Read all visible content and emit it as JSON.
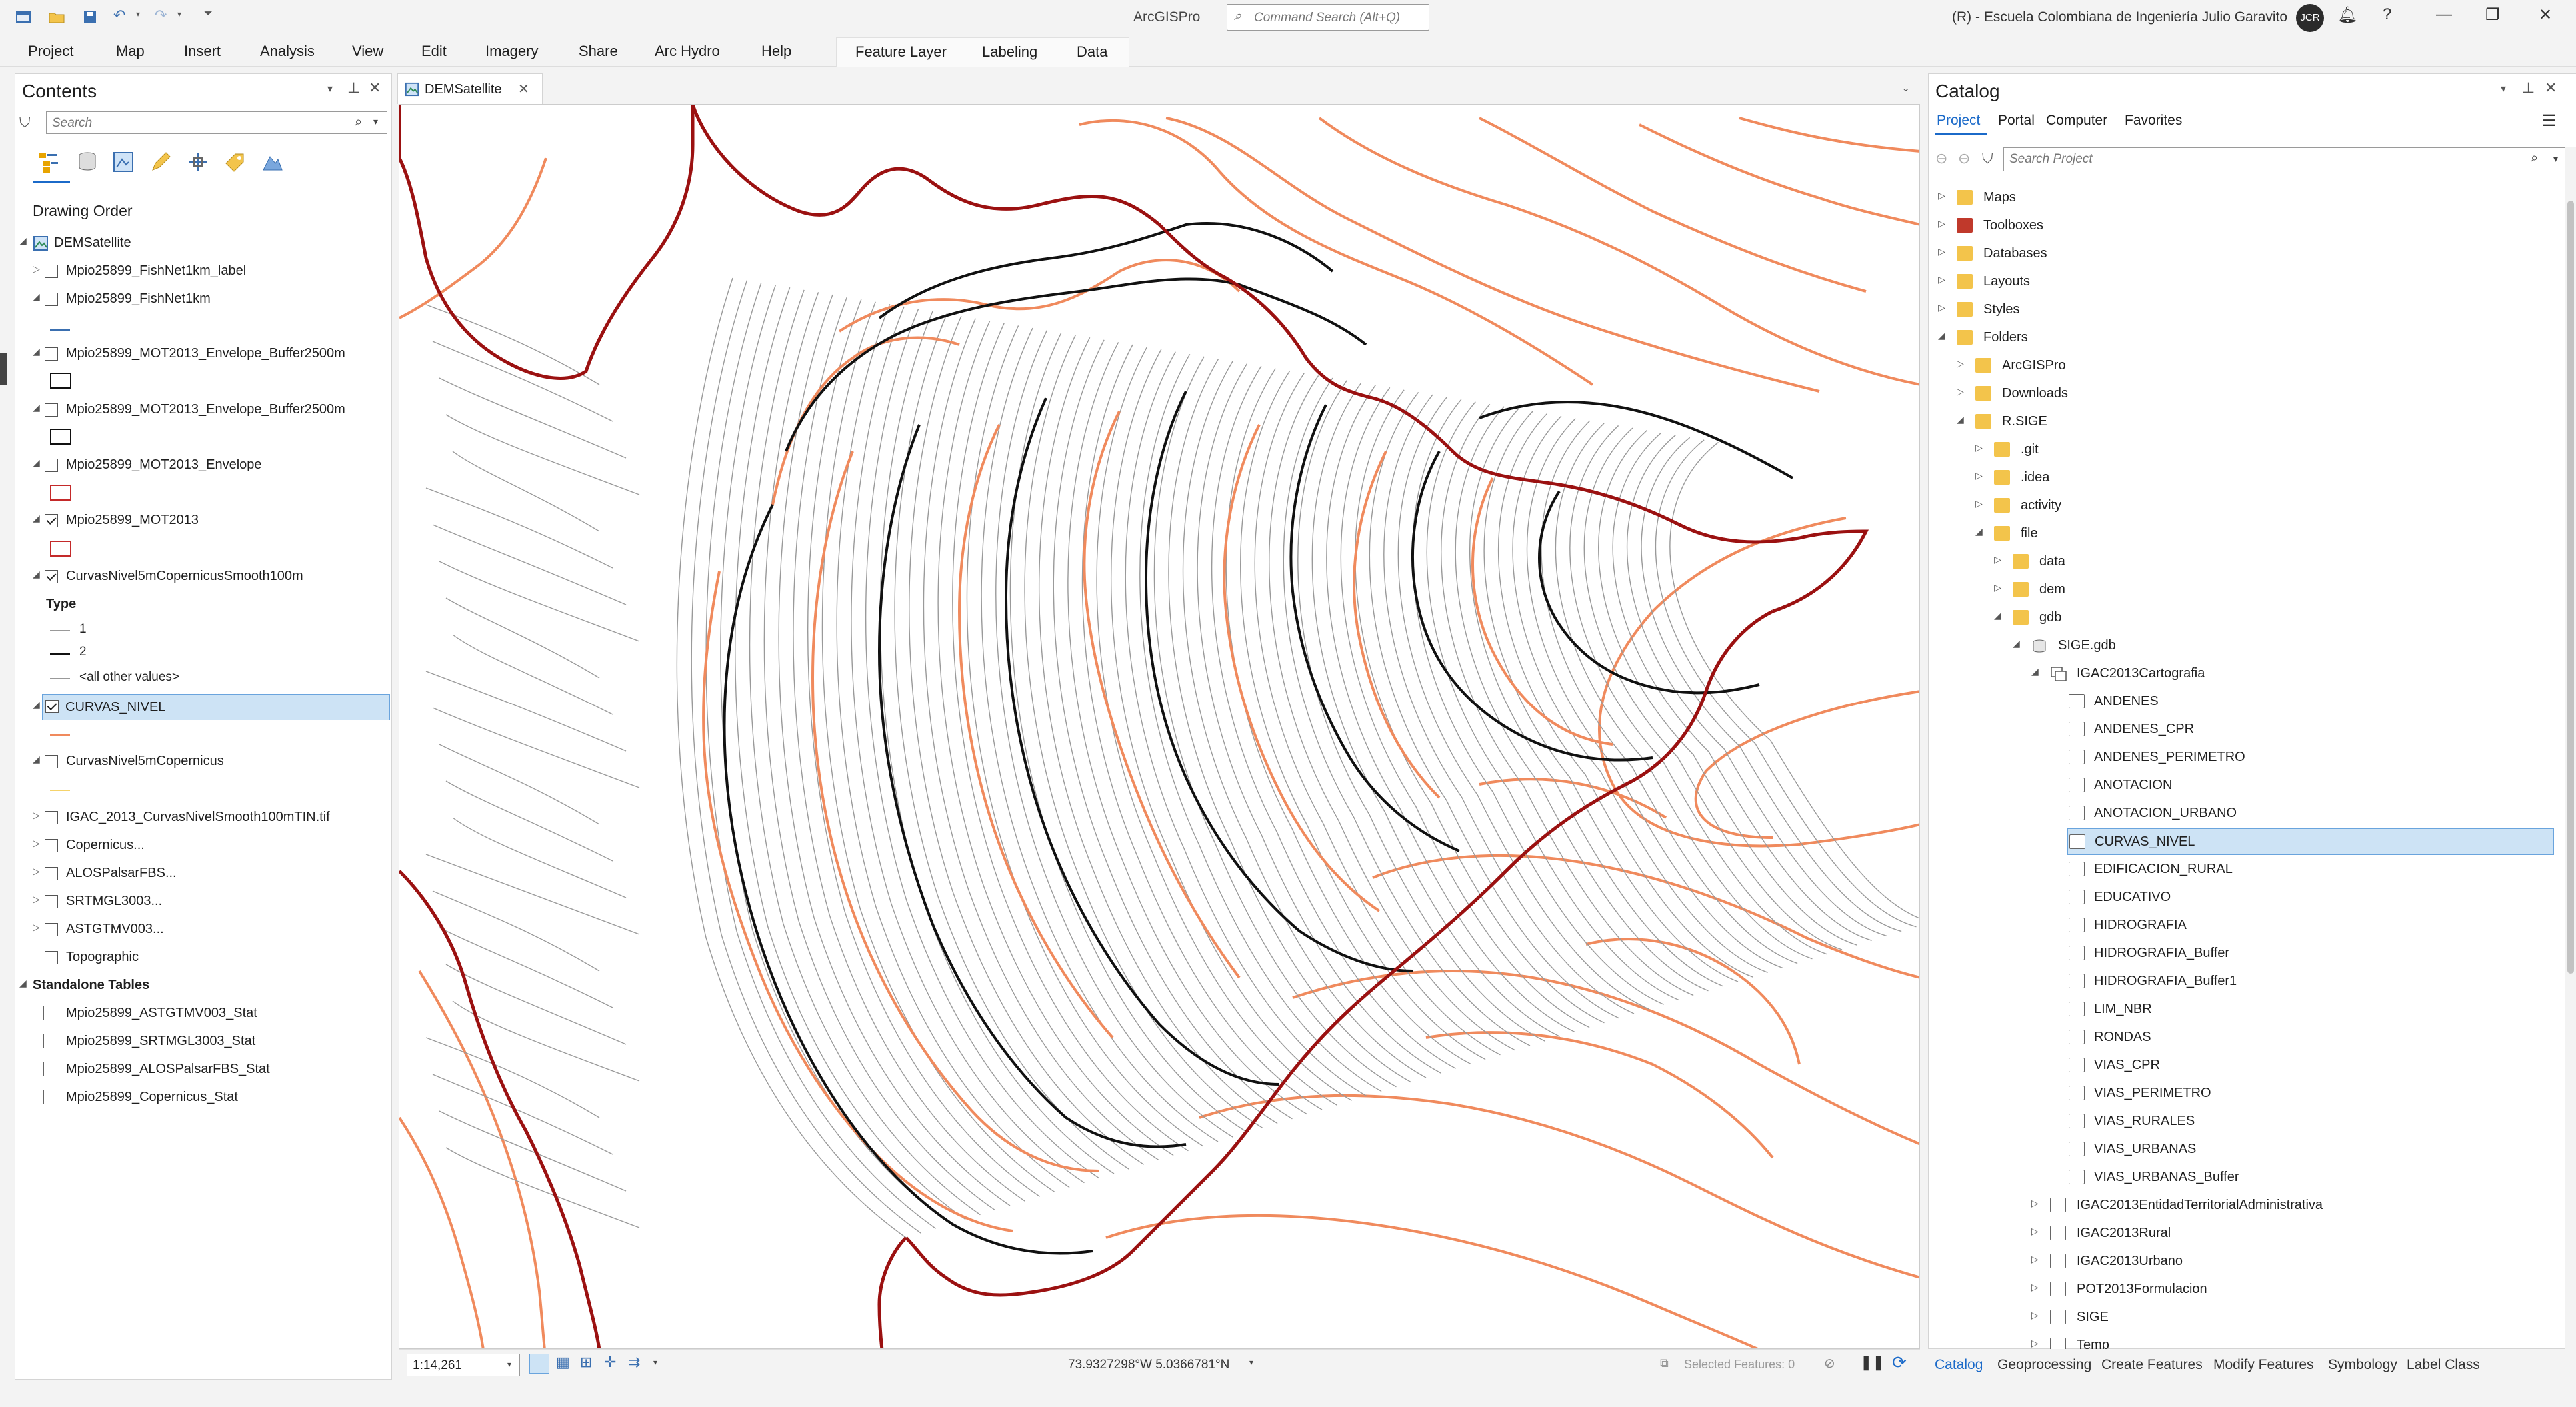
{
  "titlebar": {
    "app_title": "ArcGISPro",
    "command_search_placeholder": "Command Search (Alt+Q)",
    "org_name": "(R) - Escuela Colombiana de Ingeniería Julio Garavito",
    "avatar_initials": "JCR"
  },
  "ribbon": {
    "tabs": [
      "Project",
      "Map",
      "Insert",
      "Analysis",
      "View",
      "Edit",
      "Imagery",
      "Share",
      "Arc Hydro",
      "Help"
    ],
    "contextual_tabs": [
      "Feature Layer",
      "Labeling",
      "Data"
    ]
  },
  "contents": {
    "title": "Contents",
    "search_placeholder": "Search",
    "section_label": "Drawing Order",
    "map_name": "DEMSatellite",
    "layers": [
      {
        "label": "Mpio25899_FishNet1km_label",
        "checked": false
      },
      {
        "label": "Mpio25899_FishNet1km",
        "checked": false
      },
      {
        "label": "Mpio25899_MOT2013_Envelope_Buffer2500m",
        "checked": false
      },
      {
        "label": "Mpio25899_MOT2013_Envelope_Buffer2500m",
        "checked": false
      },
      {
        "label": "Mpio25899_MOT2013_Envelope",
        "checked": false
      },
      {
        "label": "Mpio25899_MOT2013",
        "checked": true
      },
      {
        "label": "CurvasNivel5mCopernicusSmooth100m",
        "checked": true
      },
      {
        "label": "CURVAS_NIVEL",
        "checked": true,
        "selected": true
      },
      {
        "label": "CurvasNivel5mCopernicus",
        "checked": false
      },
      {
        "label": "IGAC_2013_CurvasNivelSmooth100mTIN.tif",
        "checked": false
      },
      {
        "label": "Copernicus...",
        "checked": false
      },
      {
        "label": "ALOSPalsarFBS...",
        "checked": false
      },
      {
        "label": "SRTMGL3003...",
        "checked": false
      },
      {
        "label": "ASTGTMV003...",
        "checked": false
      },
      {
        "label": "Topographic",
        "checked": false
      }
    ],
    "legend": {
      "heading": "Type",
      "items": [
        "1",
        "2",
        "<all other values>"
      ]
    },
    "standalone_heading": "Standalone Tables",
    "tables": [
      "Mpio25899_ASTGTMV003_Stat",
      "Mpio25899_SRTMGL3003_Stat",
      "Mpio25899_ALOSPalsarFBS_Stat",
      "Mpio25899_Copernicus_Stat"
    ]
  },
  "map_view": {
    "tab_label": "DEMSatellite",
    "scale": "1:14,261",
    "coordinates": "73.9327298°W 5.0366781°N",
    "selected_features": "Selected Features: 0"
  },
  "catalog": {
    "title": "Catalog",
    "tabs": [
      "Project",
      "Portal",
      "Computer",
      "Favorites"
    ],
    "search_placeholder": "Search Project",
    "top_items": [
      "Maps",
      "Toolboxes",
      "Databases",
      "Layouts",
      "Styles",
      "Folders"
    ],
    "folders": [
      "ArcGISPro",
      "Downloads",
      "R.SIGE"
    ],
    "rsige_children": [
      ".git",
      ".idea",
      "activity",
      "file"
    ],
    "file_children": [
      "data",
      "dem",
      "gdb"
    ],
    "gdb_name": "SIGE.gdb",
    "dataset_name": "IGAC2013Cartografia",
    "feature_classes": [
      "ANDENES",
      "ANDENES_CPR",
      "ANDENES_PERIMETRO",
      "ANOTACION",
      "ANOTACION_URBANO",
      "CURVAS_NIVEL",
      "EDIFICACION_RURAL",
      "EDUCATIVO",
      "HIDROGRAFIA",
      "HIDROGRAFIA_Buffer",
      "HIDROGRAFIA_Buffer1",
      "LIM_NBR",
      "RONDAS",
      "VIAS_CPR",
      "VIAS_PERIMETRO",
      "VIAS_RURALES",
      "VIAS_URBANAS",
      "VIAS_URBANAS_Buffer"
    ],
    "selected_feature_class": "CURVAS_NIVEL",
    "other_datasets": [
      "IGAC2013EntidadTerritorialAdministrativa",
      "IGAC2013Rural",
      "IGAC2013Urbano",
      "POT2013Formulacion",
      "SIGE",
      "Temp"
    ]
  },
  "bottom_tabs": [
    "Catalog",
    "Geoprocessing",
    "Create Features",
    "Modify Features",
    "Symbology",
    "Label Class"
  ],
  "colors": {
    "boundary": "#9b1111",
    "contour_orange": "#f08a5d",
    "contour_black": "#111111",
    "contour_gray": "#8a8a8a",
    "selection": "#cde3f5",
    "accent": "#1b6ac9"
  }
}
